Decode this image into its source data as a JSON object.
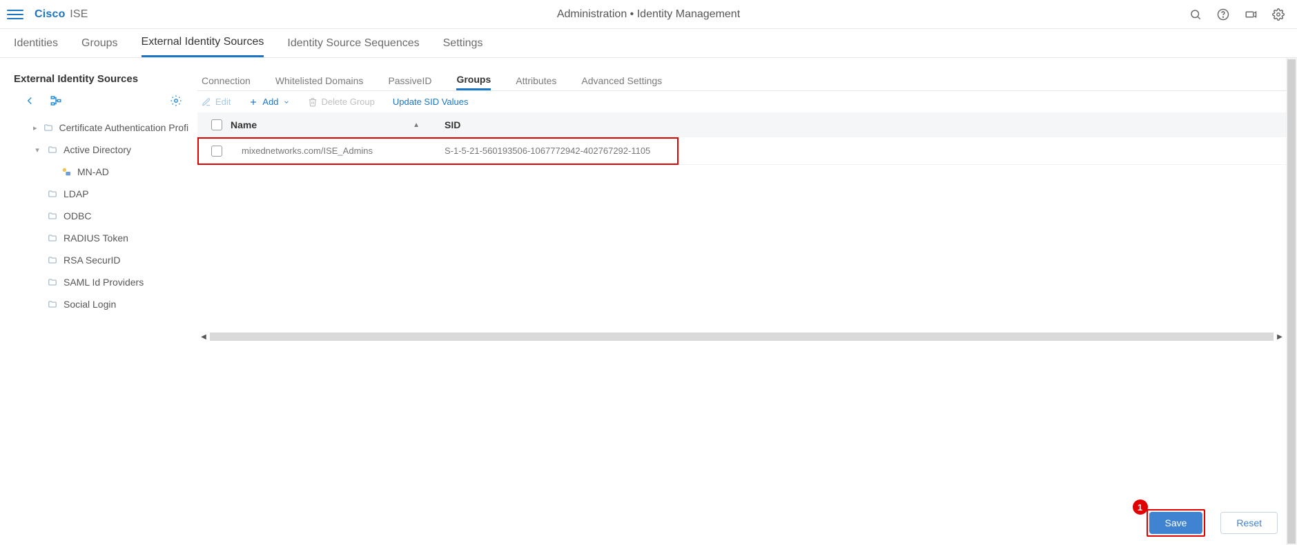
{
  "header": {
    "brand_primary": "Cisco",
    "brand_secondary": "ISE",
    "breadcrumb": "Administration • Identity Management"
  },
  "main_tabs": [
    {
      "label": "Identities",
      "active": false
    },
    {
      "label": "Groups",
      "active": false
    },
    {
      "label": "External Identity Sources",
      "active": true
    },
    {
      "label": "Identity Source Sequences",
      "active": false
    },
    {
      "label": "Settings",
      "active": false
    }
  ],
  "sidebar": {
    "title": "External Identity Sources",
    "tree": [
      {
        "label": "Certificate Authentication Profile",
        "kind": "folder",
        "expandable": true,
        "expanded": false,
        "indent": 1
      },
      {
        "label": "Active Directory",
        "kind": "folder",
        "expandable": true,
        "expanded": true,
        "indent": 1
      },
      {
        "label": "MN-AD",
        "kind": "ad-leaf",
        "expandable": false,
        "indent": 2
      },
      {
        "label": "LDAP",
        "kind": "folder",
        "expandable": false,
        "indent": 1
      },
      {
        "label": "ODBC",
        "kind": "folder",
        "expandable": false,
        "indent": 1
      },
      {
        "label": "RADIUS Token",
        "kind": "folder",
        "expandable": false,
        "indent": 1
      },
      {
        "label": "RSA SecurID",
        "kind": "folder",
        "expandable": false,
        "indent": 1
      },
      {
        "label": "SAML Id Providers",
        "kind": "folder",
        "expandable": false,
        "indent": 1
      },
      {
        "label": "Social Login",
        "kind": "folder",
        "expandable": false,
        "indent": 1
      }
    ]
  },
  "sub_tabs": [
    {
      "label": "Connection",
      "active": false
    },
    {
      "label": "Whitelisted Domains",
      "active": false
    },
    {
      "label": "PassiveID",
      "active": false
    },
    {
      "label": "Groups",
      "active": true
    },
    {
      "label": "Attributes",
      "active": false
    },
    {
      "label": "Advanced Settings",
      "active": false
    }
  ],
  "actions": {
    "edit": "Edit",
    "add": "Add",
    "delete": "Delete Group",
    "update_sid": "Update SID Values"
  },
  "table": {
    "columns": {
      "name": "Name",
      "sid": "SID"
    },
    "rows": [
      {
        "name": "mixednetworks.com/ISE_Admins",
        "sid": "S-1-5-21-560193506-1067772942-402767292-1105"
      }
    ]
  },
  "footer": {
    "save": "Save",
    "reset": "Reset",
    "annotation": "1"
  }
}
